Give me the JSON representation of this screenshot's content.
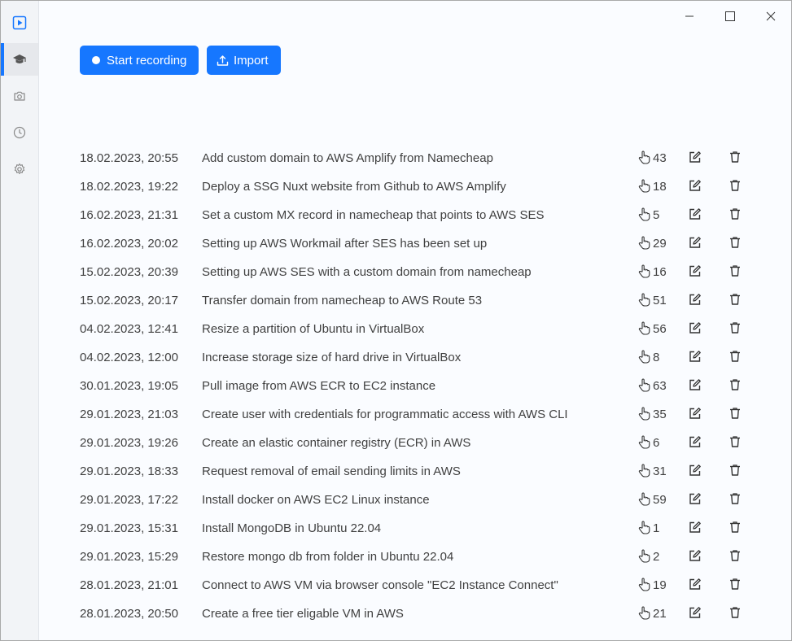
{
  "actions": {
    "start_recording_label": "Start recording",
    "import_label": "Import"
  },
  "sidebar": {
    "items": [
      {
        "icon": "play-icon"
      },
      {
        "icon": "graduation-cap-icon",
        "active": true
      },
      {
        "icon": "camera-icon"
      },
      {
        "icon": "clock-icon"
      },
      {
        "icon": "gear-icon"
      }
    ]
  },
  "colors": {
    "accent": "#1677ff",
    "sidebar_bg": "#f2f4f7",
    "page_bg": "#fafcff"
  },
  "recordings": [
    {
      "date": "18.02.2023, 20:55",
      "title": "Add custom domain to AWS Amplify from Namecheap",
      "clicks": "43"
    },
    {
      "date": "18.02.2023, 19:22",
      "title": "Deploy a SSG Nuxt website from Github to AWS Amplify",
      "clicks": "18"
    },
    {
      "date": "16.02.2023, 21:31",
      "title": "Set a custom MX record in namecheap that points to AWS SES",
      "clicks": "5"
    },
    {
      "date": "16.02.2023, 20:02",
      "title": "Setting up AWS Workmail after SES has been set up",
      "clicks": "29"
    },
    {
      "date": "15.02.2023, 20:39",
      "title": "Setting up AWS SES with a custom domain from namecheap",
      "clicks": "16"
    },
    {
      "date": "15.02.2023, 20:17",
      "title": "Transfer domain from namecheap to AWS Route 53",
      "clicks": "51"
    },
    {
      "date": "04.02.2023, 12:41",
      "title": "Resize a partition of Ubuntu in VirtualBox",
      "clicks": "56"
    },
    {
      "date": "04.02.2023, 12:00",
      "title": "Increase storage size of hard drive in VirtualBox",
      "clicks": "8"
    },
    {
      "date": "30.01.2023, 19:05",
      "title": "Pull image from AWS ECR to EC2 instance",
      "clicks": "63"
    },
    {
      "date": "29.01.2023, 21:03",
      "title": "Create user with credentials for programmatic access with AWS CLI",
      "clicks": "35"
    },
    {
      "date": "29.01.2023, 19:26",
      "title": "Create an elastic container registry (ECR) in AWS",
      "clicks": "6"
    },
    {
      "date": "29.01.2023, 18:33",
      "title": "Request removal of email sending limits in AWS",
      "clicks": "31"
    },
    {
      "date": "29.01.2023, 17:22",
      "title": "Install docker on AWS EC2 Linux instance",
      "clicks": "59"
    },
    {
      "date": "29.01.2023, 15:31",
      "title": "Install MongoDB in Ubuntu 22.04",
      "clicks": "1"
    },
    {
      "date": "29.01.2023, 15:29",
      "title": "Restore mongo db from folder in Ubuntu 22.04",
      "clicks": "2"
    },
    {
      "date": "28.01.2023, 21:01",
      "title": "Connect to AWS VM via browser console \"EC2 Instance Connect\"",
      "clicks": "19"
    },
    {
      "date": "28.01.2023, 20:50",
      "title": "Create a free tier eligable VM in AWS",
      "clicks": "21"
    }
  ]
}
